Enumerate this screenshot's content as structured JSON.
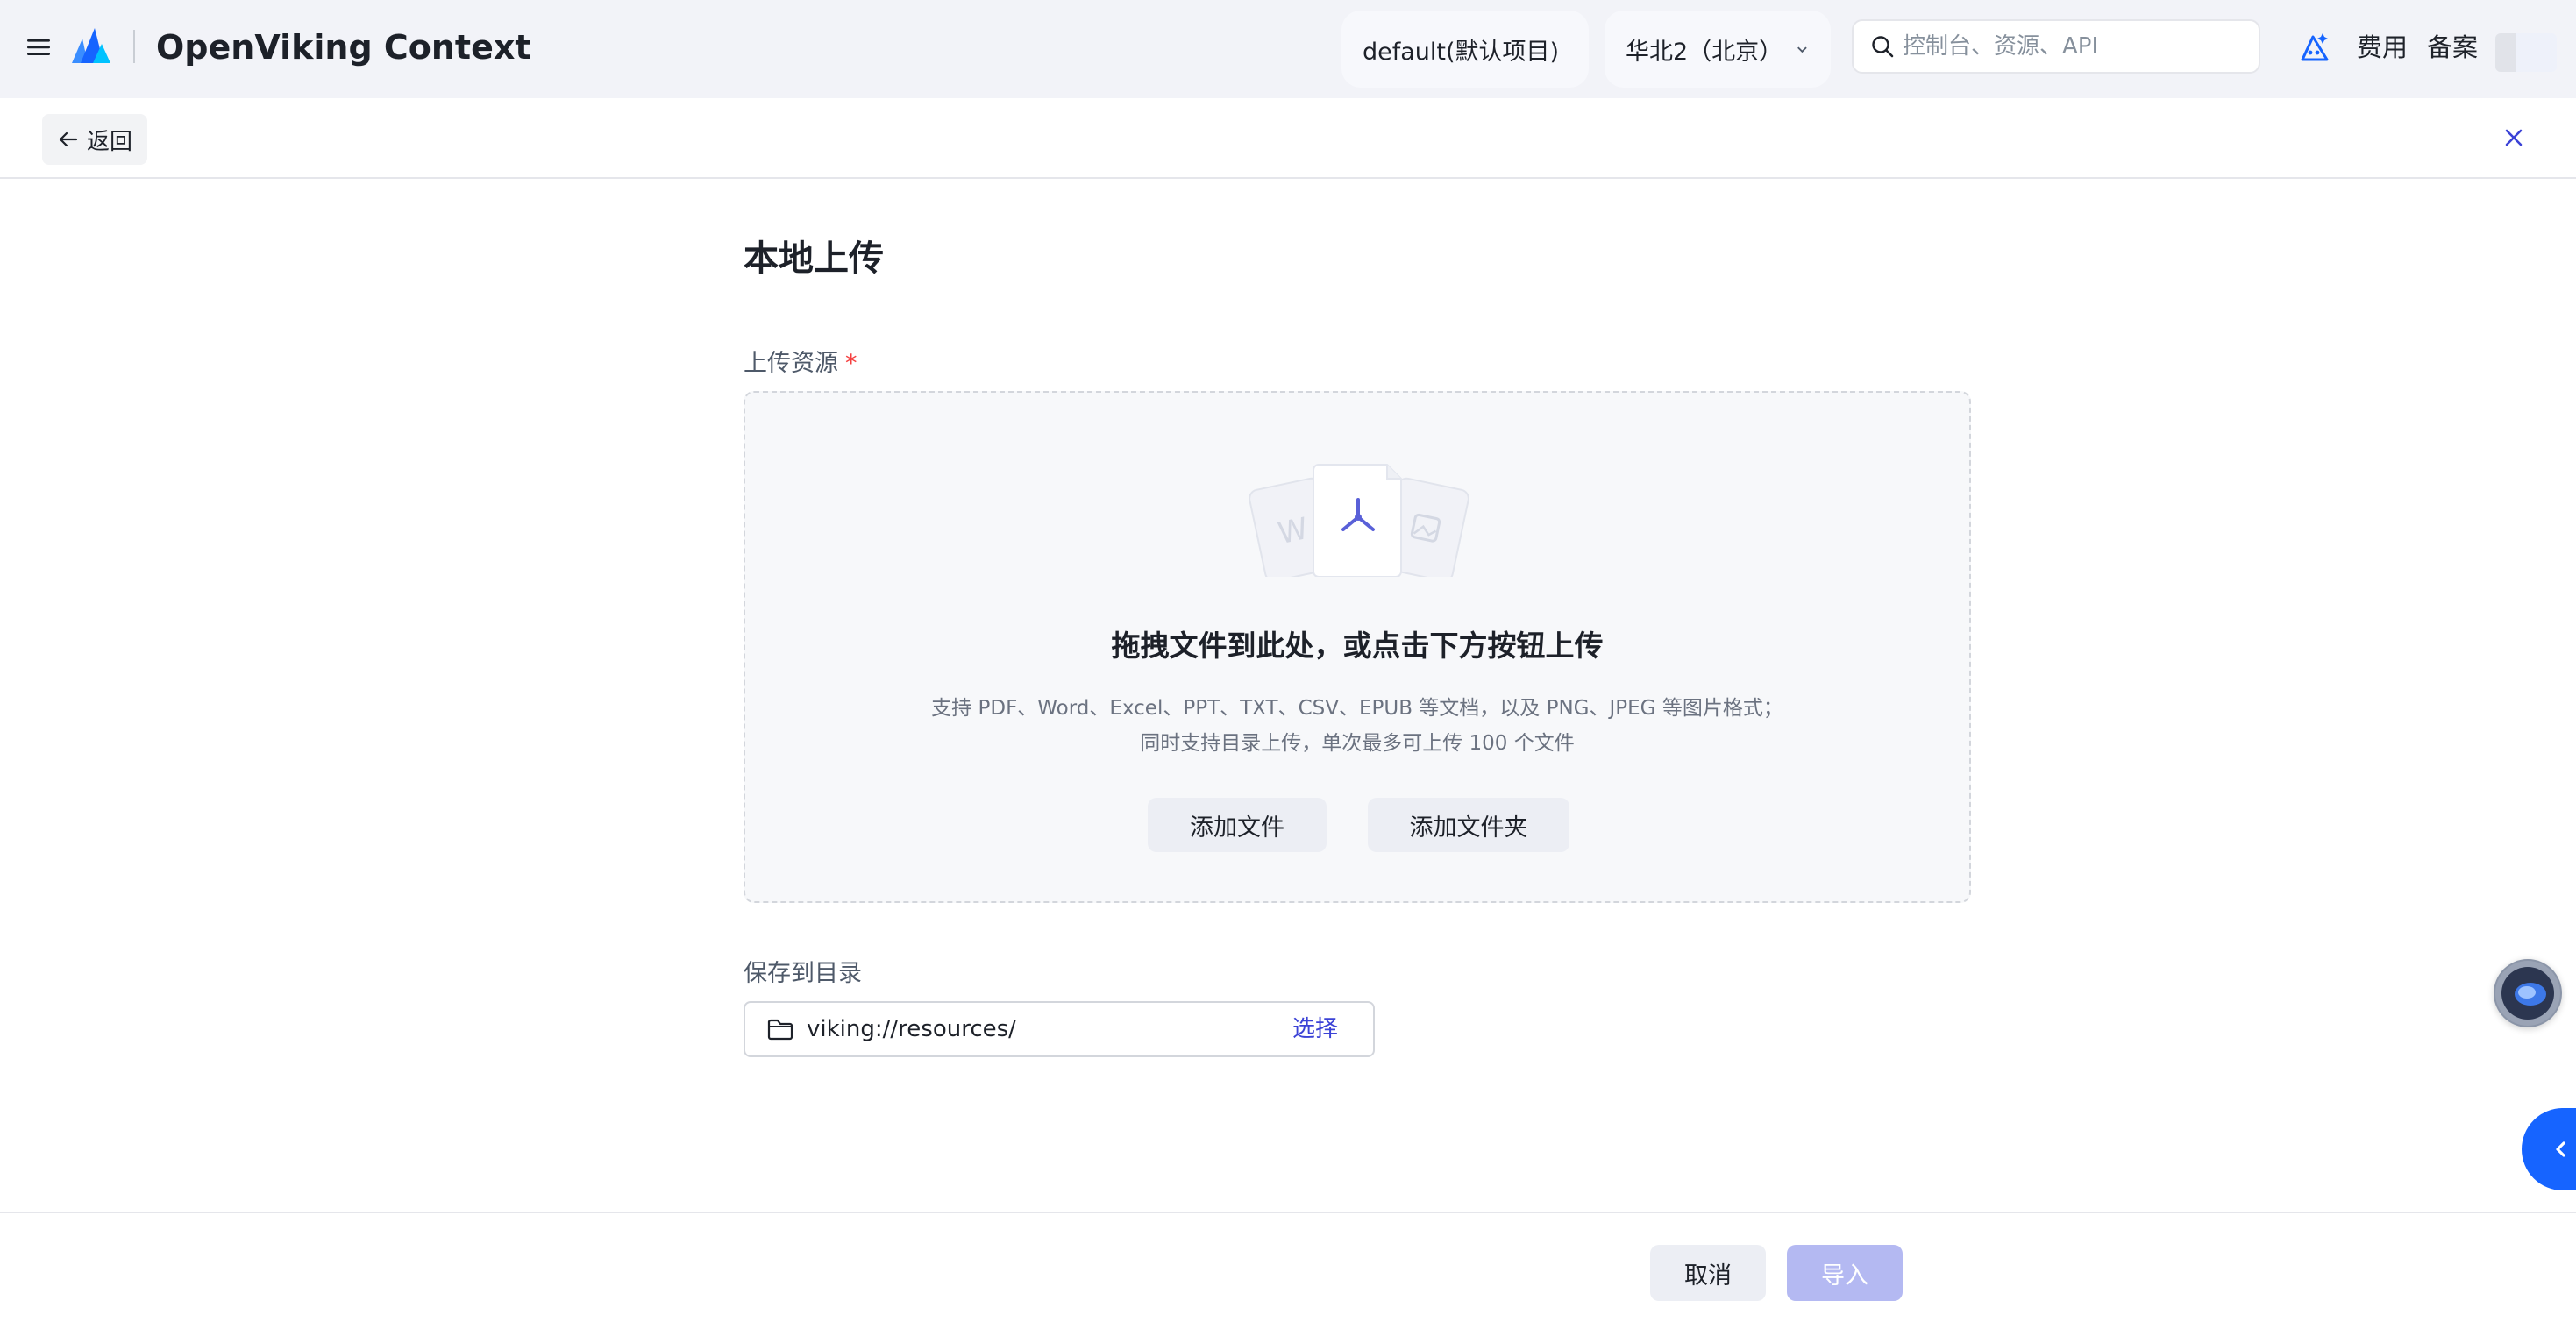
{
  "topbar": {
    "app_title": "OpenViking Context",
    "project_selector": "default(默认项目)",
    "region_selector": "华北2（北京）",
    "search_placeholder": "控制台、资源、API",
    "nav_cost": "费用",
    "nav_record": "备案",
    "icons": [
      "menu-icon",
      "logo",
      "chevron-down-icon",
      "search-icon",
      "ai-assistant-icon"
    ]
  },
  "subheader": {
    "back_label": "返回",
    "icons": [
      "arrow-left-icon",
      "close-icon"
    ]
  },
  "main": {
    "page_title": "本地上传",
    "upload_label": "上传资源",
    "required_mark": "*",
    "dropzone": {
      "title": "拖拽文件到此处，或点击下方按钮上传",
      "hint_line_1": "支持 PDF、Word、Excel、PPT、TXT、CSV、EPUB 等文档，以及 PNG、JPEG 等图片格式；",
      "hint_line_2": "同时支持目录上传，单次最多可上传 100 个文件",
      "add_file_label": "添加文件",
      "add_folder_label": "添加文件夹",
      "illustration_icons": [
        "word-doc-icon",
        "pdf-doc-icon",
        "image-doc-icon"
      ]
    },
    "save_label": "保存到目录",
    "directory_value": "viking://resources/",
    "choose_label": "选择"
  },
  "footer": {
    "cancel_label": "取消",
    "import_label": "导入"
  },
  "colors": {
    "accent": "#1664ff",
    "link": "#3b42d6",
    "import_disabled": "#b4b9f2",
    "required": "#f53f3f"
  }
}
